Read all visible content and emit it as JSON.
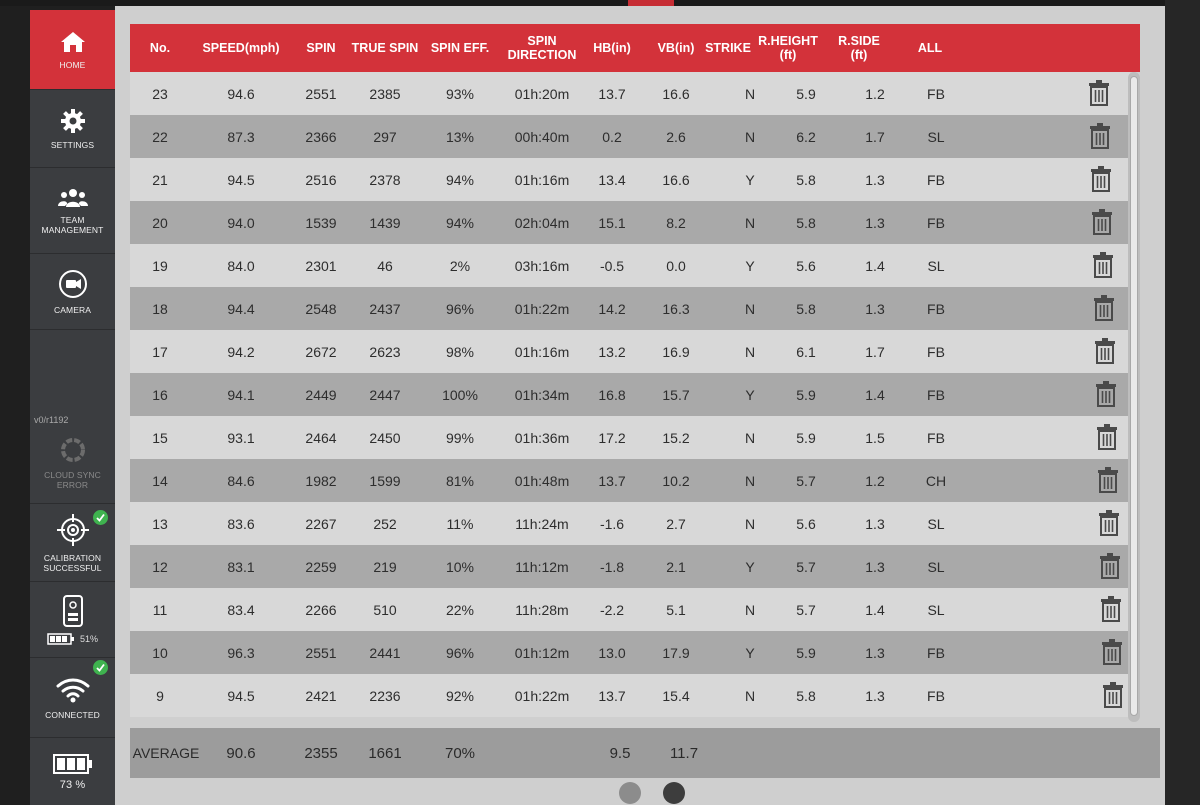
{
  "sidebar": {
    "items": [
      {
        "label": "HOME",
        "icon": "home-icon",
        "active": true
      },
      {
        "label": "SETTINGS",
        "icon": "gear-icon"
      },
      {
        "label": "TEAM\nMANAGEMENT",
        "icon": "team-icon"
      },
      {
        "label": "CAMERA",
        "icon": "camera-icon"
      }
    ],
    "version": "v0/r1192",
    "cloud_sync": "CLOUD SYNC\nERROR",
    "calibration": "CALIBRATION\nSUCCESSFUL",
    "device_battery": "51%",
    "wifi": "CONNECTED",
    "tablet_battery": "73 %"
  },
  "table": {
    "columns": [
      "No.",
      "SPEED(mph)",
      "SPIN",
      "TRUE SPIN",
      "SPIN EFF.",
      "SPIN\nDIRECTION",
      "HB(in)",
      "VB(in)",
      "STRIKE",
      "R.HEIGHT\n(ft)",
      "R.SIDE\n(ft)",
      "ALL"
    ],
    "rows": [
      [
        "23",
        "94.6",
        "2551",
        "2385",
        "93%",
        "01h:20m",
        "13.7",
        "16.6",
        "N",
        "5.9",
        "1.2",
        "FB"
      ],
      [
        "22",
        "87.3",
        "2366",
        "297",
        "13%",
        "00h:40m",
        "0.2",
        "2.6",
        "N",
        "6.2",
        "1.7",
        "SL"
      ],
      [
        "21",
        "94.5",
        "2516",
        "2378",
        "94%",
        "01h:16m",
        "13.4",
        "16.6",
        "Y",
        "5.8",
        "1.3",
        "FB"
      ],
      [
        "20",
        "94.0",
        "1539",
        "1439",
        "94%",
        "02h:04m",
        "15.1",
        "8.2",
        "N",
        "5.8",
        "1.3",
        "FB"
      ],
      [
        "19",
        "84.0",
        "2301",
        "46",
        "2%",
        "03h:16m",
        "-0.5",
        "0.0",
        "Y",
        "5.6",
        "1.4",
        "SL"
      ],
      [
        "18",
        "94.4",
        "2548",
        "2437",
        "96%",
        "01h:22m",
        "14.2",
        "16.3",
        "N",
        "5.8",
        "1.3",
        "FB"
      ],
      [
        "17",
        "94.2",
        "2672",
        "2623",
        "98%",
        "01h:16m",
        "13.2",
        "16.9",
        "N",
        "6.1",
        "1.7",
        "FB"
      ],
      [
        "16",
        "94.1",
        "2449",
        "2447",
        "100%",
        "01h:34m",
        "16.8",
        "15.7",
        "Y",
        "5.9",
        "1.4",
        "FB"
      ],
      [
        "15",
        "93.1",
        "2464",
        "2450",
        "99%",
        "01h:36m",
        "17.2",
        "15.2",
        "N",
        "5.9",
        "1.5",
        "FB"
      ],
      [
        "14",
        "84.6",
        "1982",
        "1599",
        "81%",
        "01h:48m",
        "13.7",
        "10.2",
        "N",
        "5.7",
        "1.2",
        "CH"
      ],
      [
        "13",
        "83.6",
        "2267",
        "252",
        "11%",
        "11h:24m",
        "-1.6",
        "2.7",
        "N",
        "5.6",
        "1.3",
        "SL"
      ],
      [
        "12",
        "83.1",
        "2259",
        "219",
        "10%",
        "11h:12m",
        "-1.8",
        "2.1",
        "Y",
        "5.7",
        "1.3",
        "SL"
      ],
      [
        "11",
        "83.4",
        "2266",
        "510",
        "22%",
        "11h:28m",
        "-2.2",
        "5.1",
        "N",
        "5.7",
        "1.4",
        "SL"
      ],
      [
        "10",
        "96.3",
        "2551",
        "2441",
        "96%",
        "01h:12m",
        "13.0",
        "17.9",
        "Y",
        "5.9",
        "1.3",
        "FB"
      ],
      [
        "9",
        "94.5",
        "2421",
        "2236",
        "92%",
        "01h:22m",
        "13.7",
        "15.4",
        "N",
        "5.8",
        "1.3",
        "FB"
      ]
    ]
  },
  "average": {
    "label": "AVERAGE",
    "speed": "90.6",
    "spin": "2355",
    "true_spin": "1661",
    "spin_eff": "70%",
    "hb": "9.5",
    "vb": "11.7"
  },
  "colors": {
    "accent": "#d3323a",
    "sidebar": "#3b3d40",
    "check": "#3fb34f"
  },
  "pager": {
    "pages": 2,
    "current": 2
  }
}
